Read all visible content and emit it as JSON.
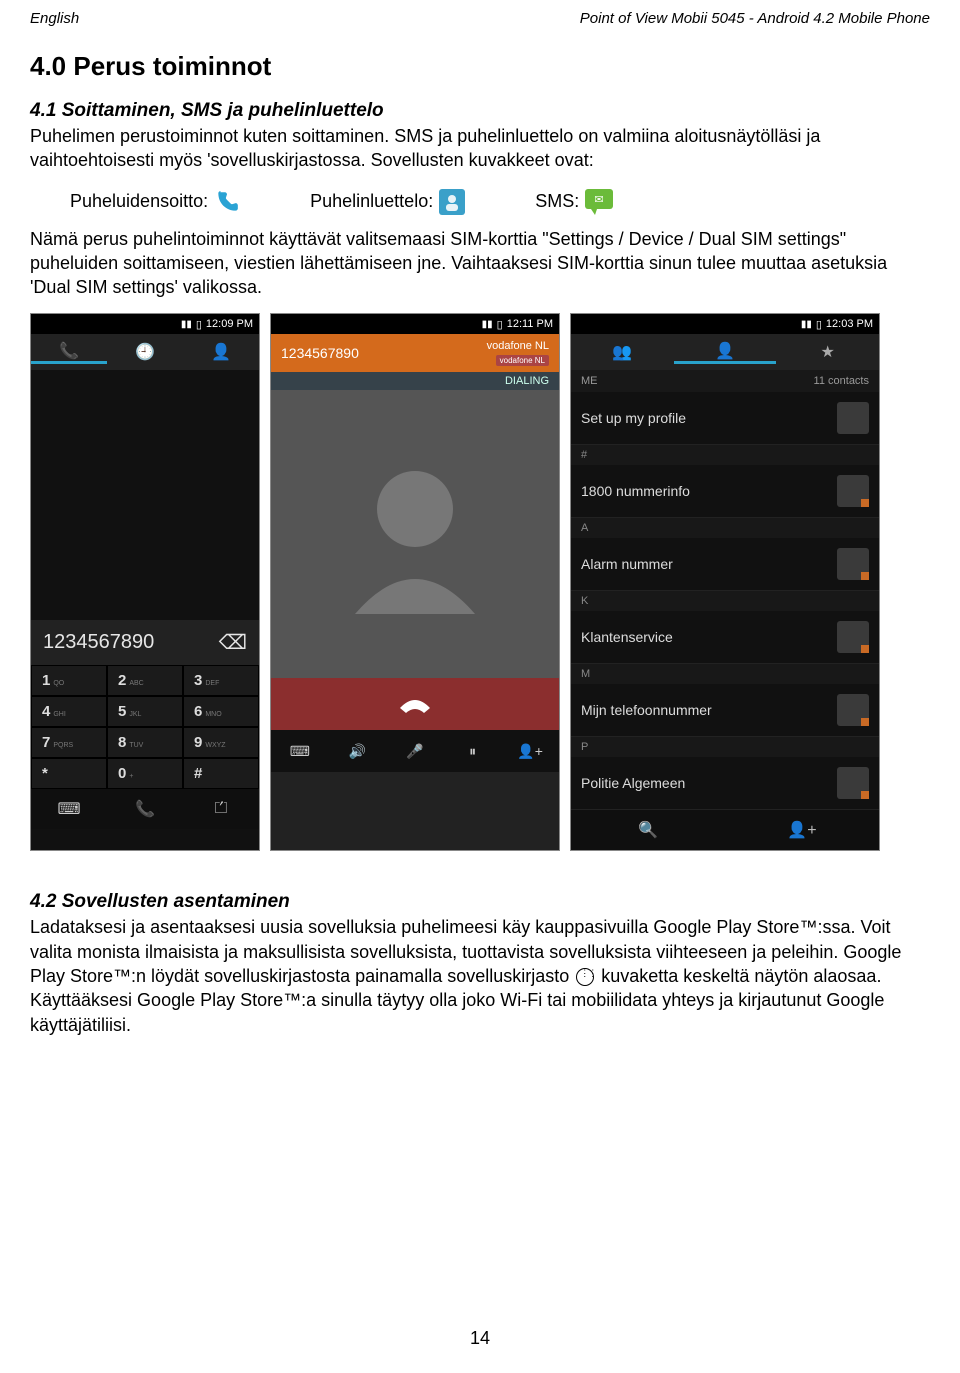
{
  "header": {
    "left": "English",
    "right": "Point of View Mobii 5045 - Android 4.2 Mobile Phone"
  },
  "h1": "4.0 Perus toiminnot",
  "s41": {
    "title": "4.1 Soittaminen, SMS ja puhelinluettelo",
    "p1": "Puhelimen perustoiminnot kuten soittaminen. SMS ja puhelinluettelo on valmiina aloitusnäytölläsi ja vaihtoehtoisesti myös 'sovelluskirjastossa. Sovellusten kuvakkeet ovat:",
    "lbl_dial": "Puheluidensoitto:",
    "lbl_contacts": "Puhelinluettelo:",
    "lbl_sms": "SMS:",
    "p2": "Nämä perus puhelintoiminnot käyttävät valitsemaasi SIM-korttia \"Settings / Device / Dual SIM settings\" puheluiden soittamiseen, viestien lähettämiseen jne. Vaihtaaksesi SIM-korttia sinun tulee muuttaa asetuksia 'Dual SIM settings' valikossa."
  },
  "dialer": {
    "time": "12:09 PM",
    "number": "1234567890",
    "keys": [
      {
        "n": "1",
        "s": "QO"
      },
      {
        "n": "2",
        "s": "ABC"
      },
      {
        "n": "3",
        "s": "DEF"
      },
      {
        "n": "4",
        "s": "GHI"
      },
      {
        "n": "5",
        "s": "JKL"
      },
      {
        "n": "6",
        "s": "MNO"
      },
      {
        "n": "7",
        "s": "PQRS"
      },
      {
        "n": "8",
        "s": "TUV"
      },
      {
        "n": "9",
        "s": "WXYZ"
      },
      {
        "n": "*",
        "s": ""
      },
      {
        "n": "0",
        "s": "+"
      },
      {
        "n": "#",
        "s": ""
      }
    ]
  },
  "calling": {
    "time": "12:11 PM",
    "number": "1234567890",
    "operator": "vodafone NL",
    "tag": "vodafone NL",
    "status": "DIALING"
  },
  "contacts": {
    "time": "12:03 PM",
    "me": "ME",
    "me_count": "11 contacts",
    "profile": "Set up my profile",
    "items": [
      {
        "sect": "#",
        "name": "1800 nummerinfo"
      },
      {
        "sect": "A",
        "name": "Alarm nummer"
      },
      {
        "sect": "K",
        "name": "Klantenservice"
      },
      {
        "sect": "M",
        "name": "Mijn telefoonnummer"
      },
      {
        "sect": "P",
        "name": "Politie Algemeen"
      }
    ]
  },
  "s42": {
    "title": "4.2 Sovellusten asentaminen",
    "p_a": "Ladataksesi ja asentaaksesi uusia sovelluksia puhelimeesi käy kauppasivuilla Google Play Store™:ssa. Voit valita monista ilmaisista ja maksullisista sovelluksista, tuottavista sovelluksista viihteeseen ja peleihin. Google Play Store™:n löydät sovelluskirjastosta painamalla sovelluskirjasto ",
    "p_b": " kuvaketta keskeltä näytön alaosaa. Käyttääksesi Google Play Store™:a sinulla täytyy olla joko Wi-Fi tai mobiilidata yhteys ja kirjautunut Google käyttäjätiliisi."
  },
  "pagenum": "14"
}
